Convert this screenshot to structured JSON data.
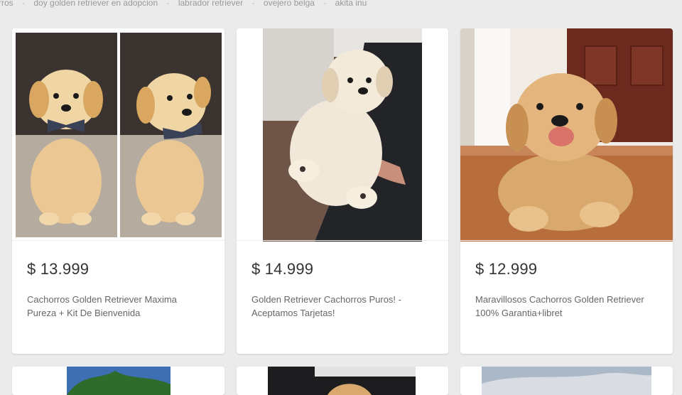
{
  "related_searches": [
    "rros",
    "doy golden retriever en adopcion",
    "labrador retriever",
    "ovejero belga",
    "akita inu"
  ],
  "listings": [
    {
      "price": "$ 13.999",
      "title": "Cachorros Golden Retriever Maxima Pureza + Kit De Bienvenida",
      "image": "golden-puppy-bowtie-photo"
    },
    {
      "price": "$ 14.999",
      "title": "Golden Retriever Cachorros Puros! - Aceptamos Tarjetas!",
      "image": "golden-puppy-held-photo"
    },
    {
      "price": "$ 12.999",
      "title": "Maravillosos Cachorros Golden Retriever 100% Garantia+libret",
      "image": "golden-puppy-smiling-photo"
    }
  ],
  "colors": {
    "page_bg": "#ebebeb",
    "card_bg": "#ffffff",
    "price_text": "#333333",
    "title_text": "#666666",
    "related_text": "#999999"
  }
}
